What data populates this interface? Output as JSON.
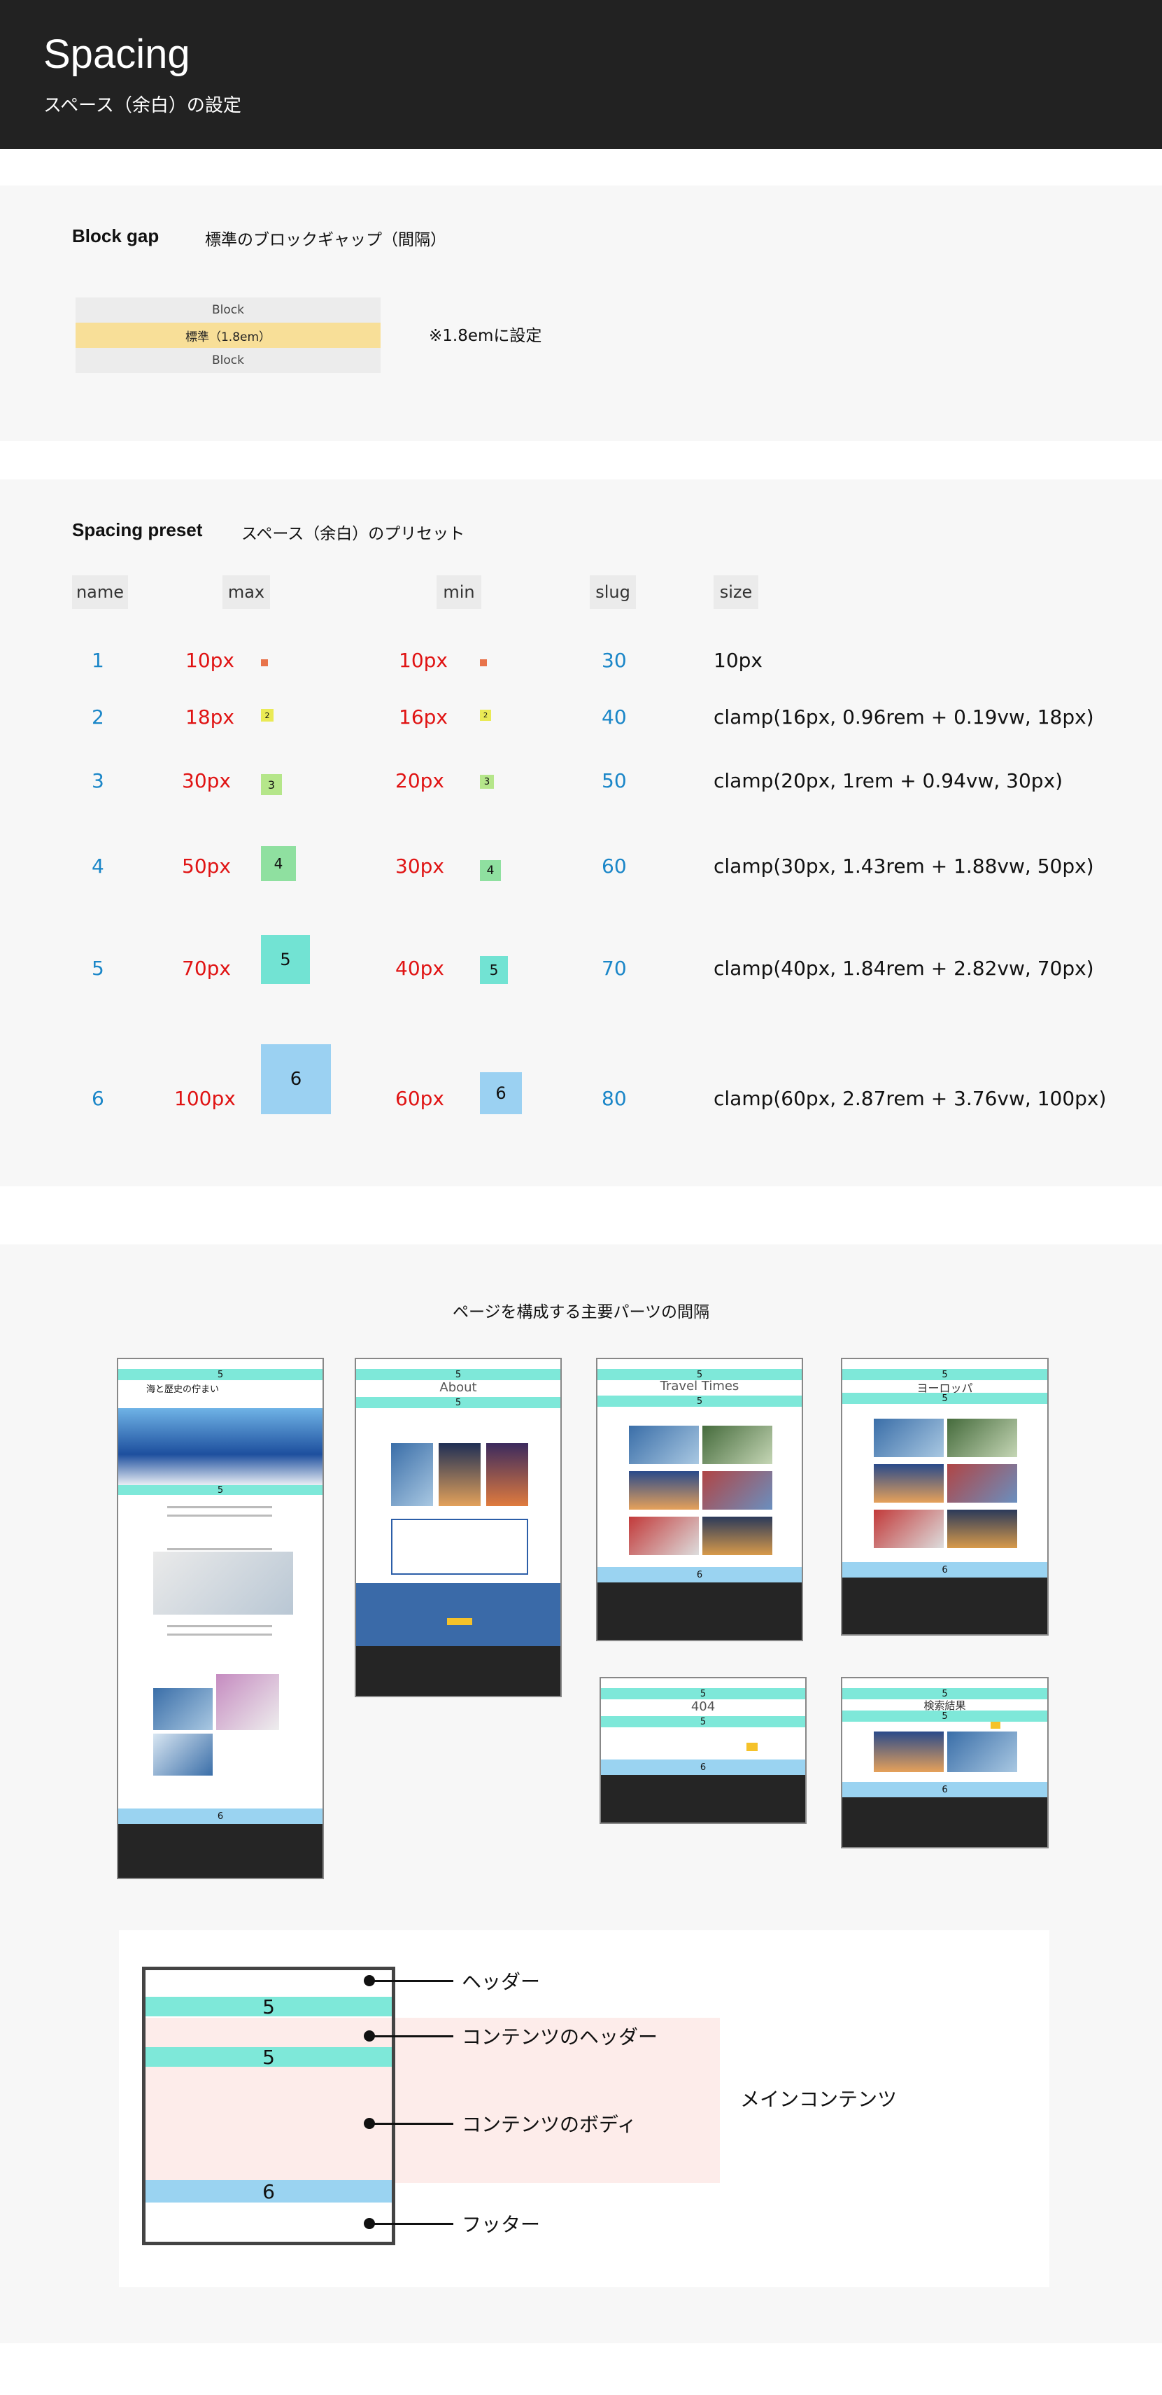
{
  "header": {
    "title": "Spacing",
    "subtitle": "スペース（余白）の設定"
  },
  "block_gap": {
    "title": "Block gap",
    "description": "標準のブロックギャップ（間隔）",
    "blocks": [
      "Block",
      "標準（1.8em）",
      "Block"
    ],
    "note": "※1.8emに設定"
  },
  "spacing_preset": {
    "title": "Spacing preset",
    "description": "スペース（余白）のプリセット",
    "columns": [
      "name",
      "max",
      "min",
      "slug",
      "size"
    ],
    "rows": [
      {
        "name": "1",
        "max": "10px",
        "min": "10px",
        "slug": "30",
        "size": "10px",
        "max_swatch": "",
        "min_swatch": ""
      },
      {
        "name": "2",
        "max": "18px",
        "min": "16px",
        "slug": "40",
        "size": "clamp(16px, 0.96rem + 0.19vw, 18px)",
        "max_swatch": "2",
        "min_swatch": "2"
      },
      {
        "name": "3",
        "max": "30px",
        "min": "20px",
        "slug": "50",
        "size": "clamp(20px, 1rem + 0.94vw, 30px)",
        "max_swatch": "3",
        "min_swatch": "3"
      },
      {
        "name": "4",
        "max": "50px",
        "min": "30px",
        "slug": "60",
        "size": "clamp(30px, 1.43rem + 1.88vw, 50px)",
        "max_swatch": "4",
        "min_swatch": "4"
      },
      {
        "name": "5",
        "max": "70px",
        "min": "40px",
        "slug": "70",
        "size": "clamp(40px, 1.84rem + 2.82vw, 70px)",
        "max_swatch": "5",
        "min_swatch": "5"
      },
      {
        "name": "6",
        "max": "100px",
        "min": "60px",
        "slug": "80",
        "size": "clamp(60px, 2.87rem + 3.76vw, 100px)",
        "max_swatch": "6",
        "min_swatch": "6"
      }
    ],
    "swatch_colors": [
      "#e8734a",
      "#eaea55",
      "#b5e68a",
      "#8fe0a0",
      "#72e3d3",
      "#9bd1f2"
    ]
  },
  "parts": {
    "title": "ページを構成する主要パーツの間隔",
    "thumbnails": [
      {
        "heading": "海と歴史の佇まい",
        "gap_top": "5",
        "gap_mid": "5",
        "gap_bottom": "6"
      },
      {
        "heading": "About",
        "gap_top": "5",
        "gap_mid": "5"
      },
      {
        "heading": "Travel Times",
        "gap_top": "5",
        "gap_mid": "5",
        "gap_bottom": "6"
      },
      {
        "heading": "ヨーロッパ",
        "gap_top": "5",
        "gap_mid": "5",
        "gap_bottom": "6"
      },
      {
        "heading": "404",
        "gap_top": "5",
        "gap_mid": "5",
        "gap_bottom": "6"
      },
      {
        "heading": "検索結果",
        "gap_top": "5",
        "gap_mid": "5",
        "gap_bottom": "6"
      }
    ]
  },
  "diagram": {
    "gaps": [
      "5",
      "5",
      "6"
    ],
    "labels": [
      "ヘッダー",
      "コンテンツのヘッダー",
      "コンテンツのボディ",
      "フッター"
    ],
    "main_label": "メインコンテンツ"
  },
  "colors": {
    "cyan": "#7ee8d9",
    "light_blue": "#9ad3f1",
    "pink": "#fdecea",
    "yellow": "#f8df98",
    "red": "#e01313",
    "blue": "#1a86c8"
  }
}
